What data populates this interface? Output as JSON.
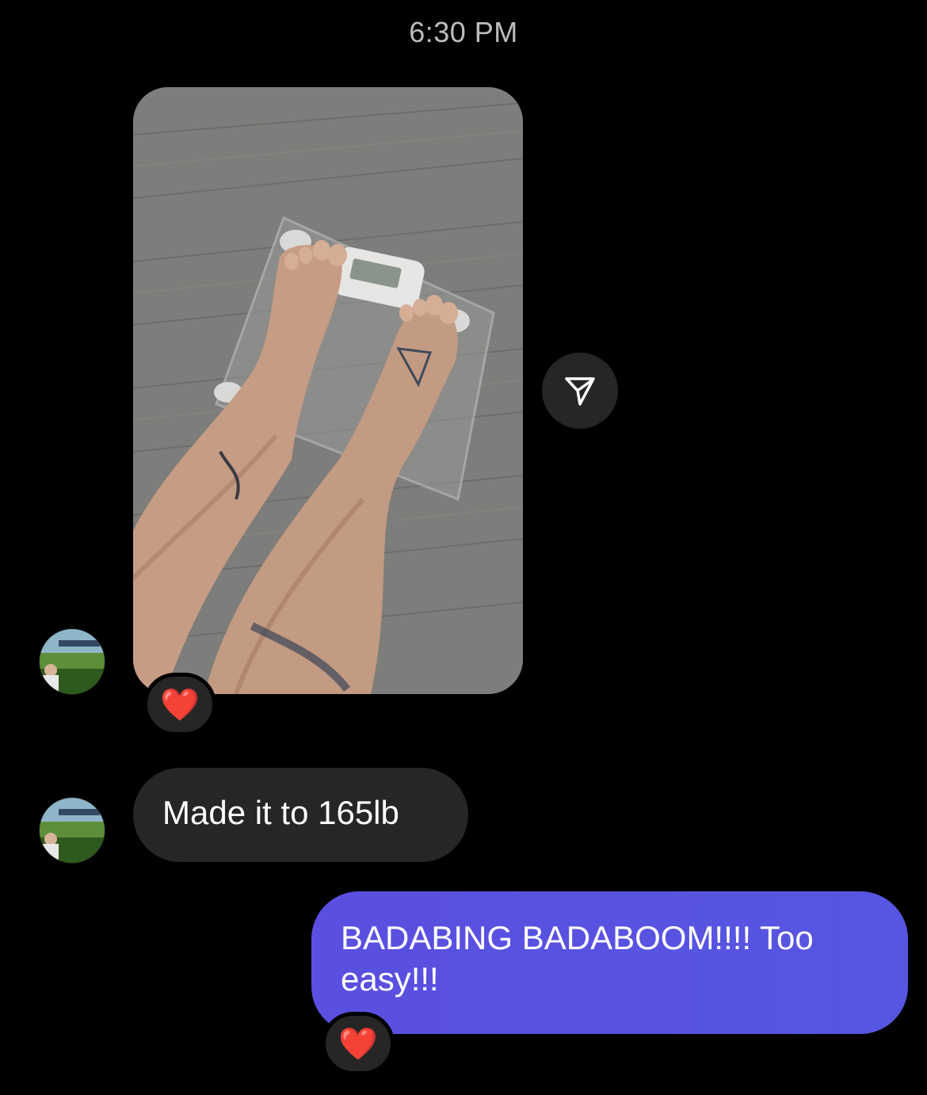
{
  "thread": {
    "timestamp": "6:30 PM"
  },
  "messages": [
    {
      "from": "contact",
      "type": "photo",
      "reaction": "❤️"
    },
    {
      "from": "contact",
      "type": "text",
      "text": "Made it to 165lb"
    },
    {
      "from": "me",
      "type": "text",
      "text": "BADABING BADABOOM!!!! Too easy!!!",
      "reaction": "❤️"
    }
  ],
  "icons": {
    "share": "paper-plane-icon",
    "reaction": "red-heart"
  },
  "colors": {
    "background": "#000000",
    "incoming_bubble": "#262626",
    "outgoing_bubble": "#5856E0",
    "timestamp_text": "#BDBDBD"
  }
}
